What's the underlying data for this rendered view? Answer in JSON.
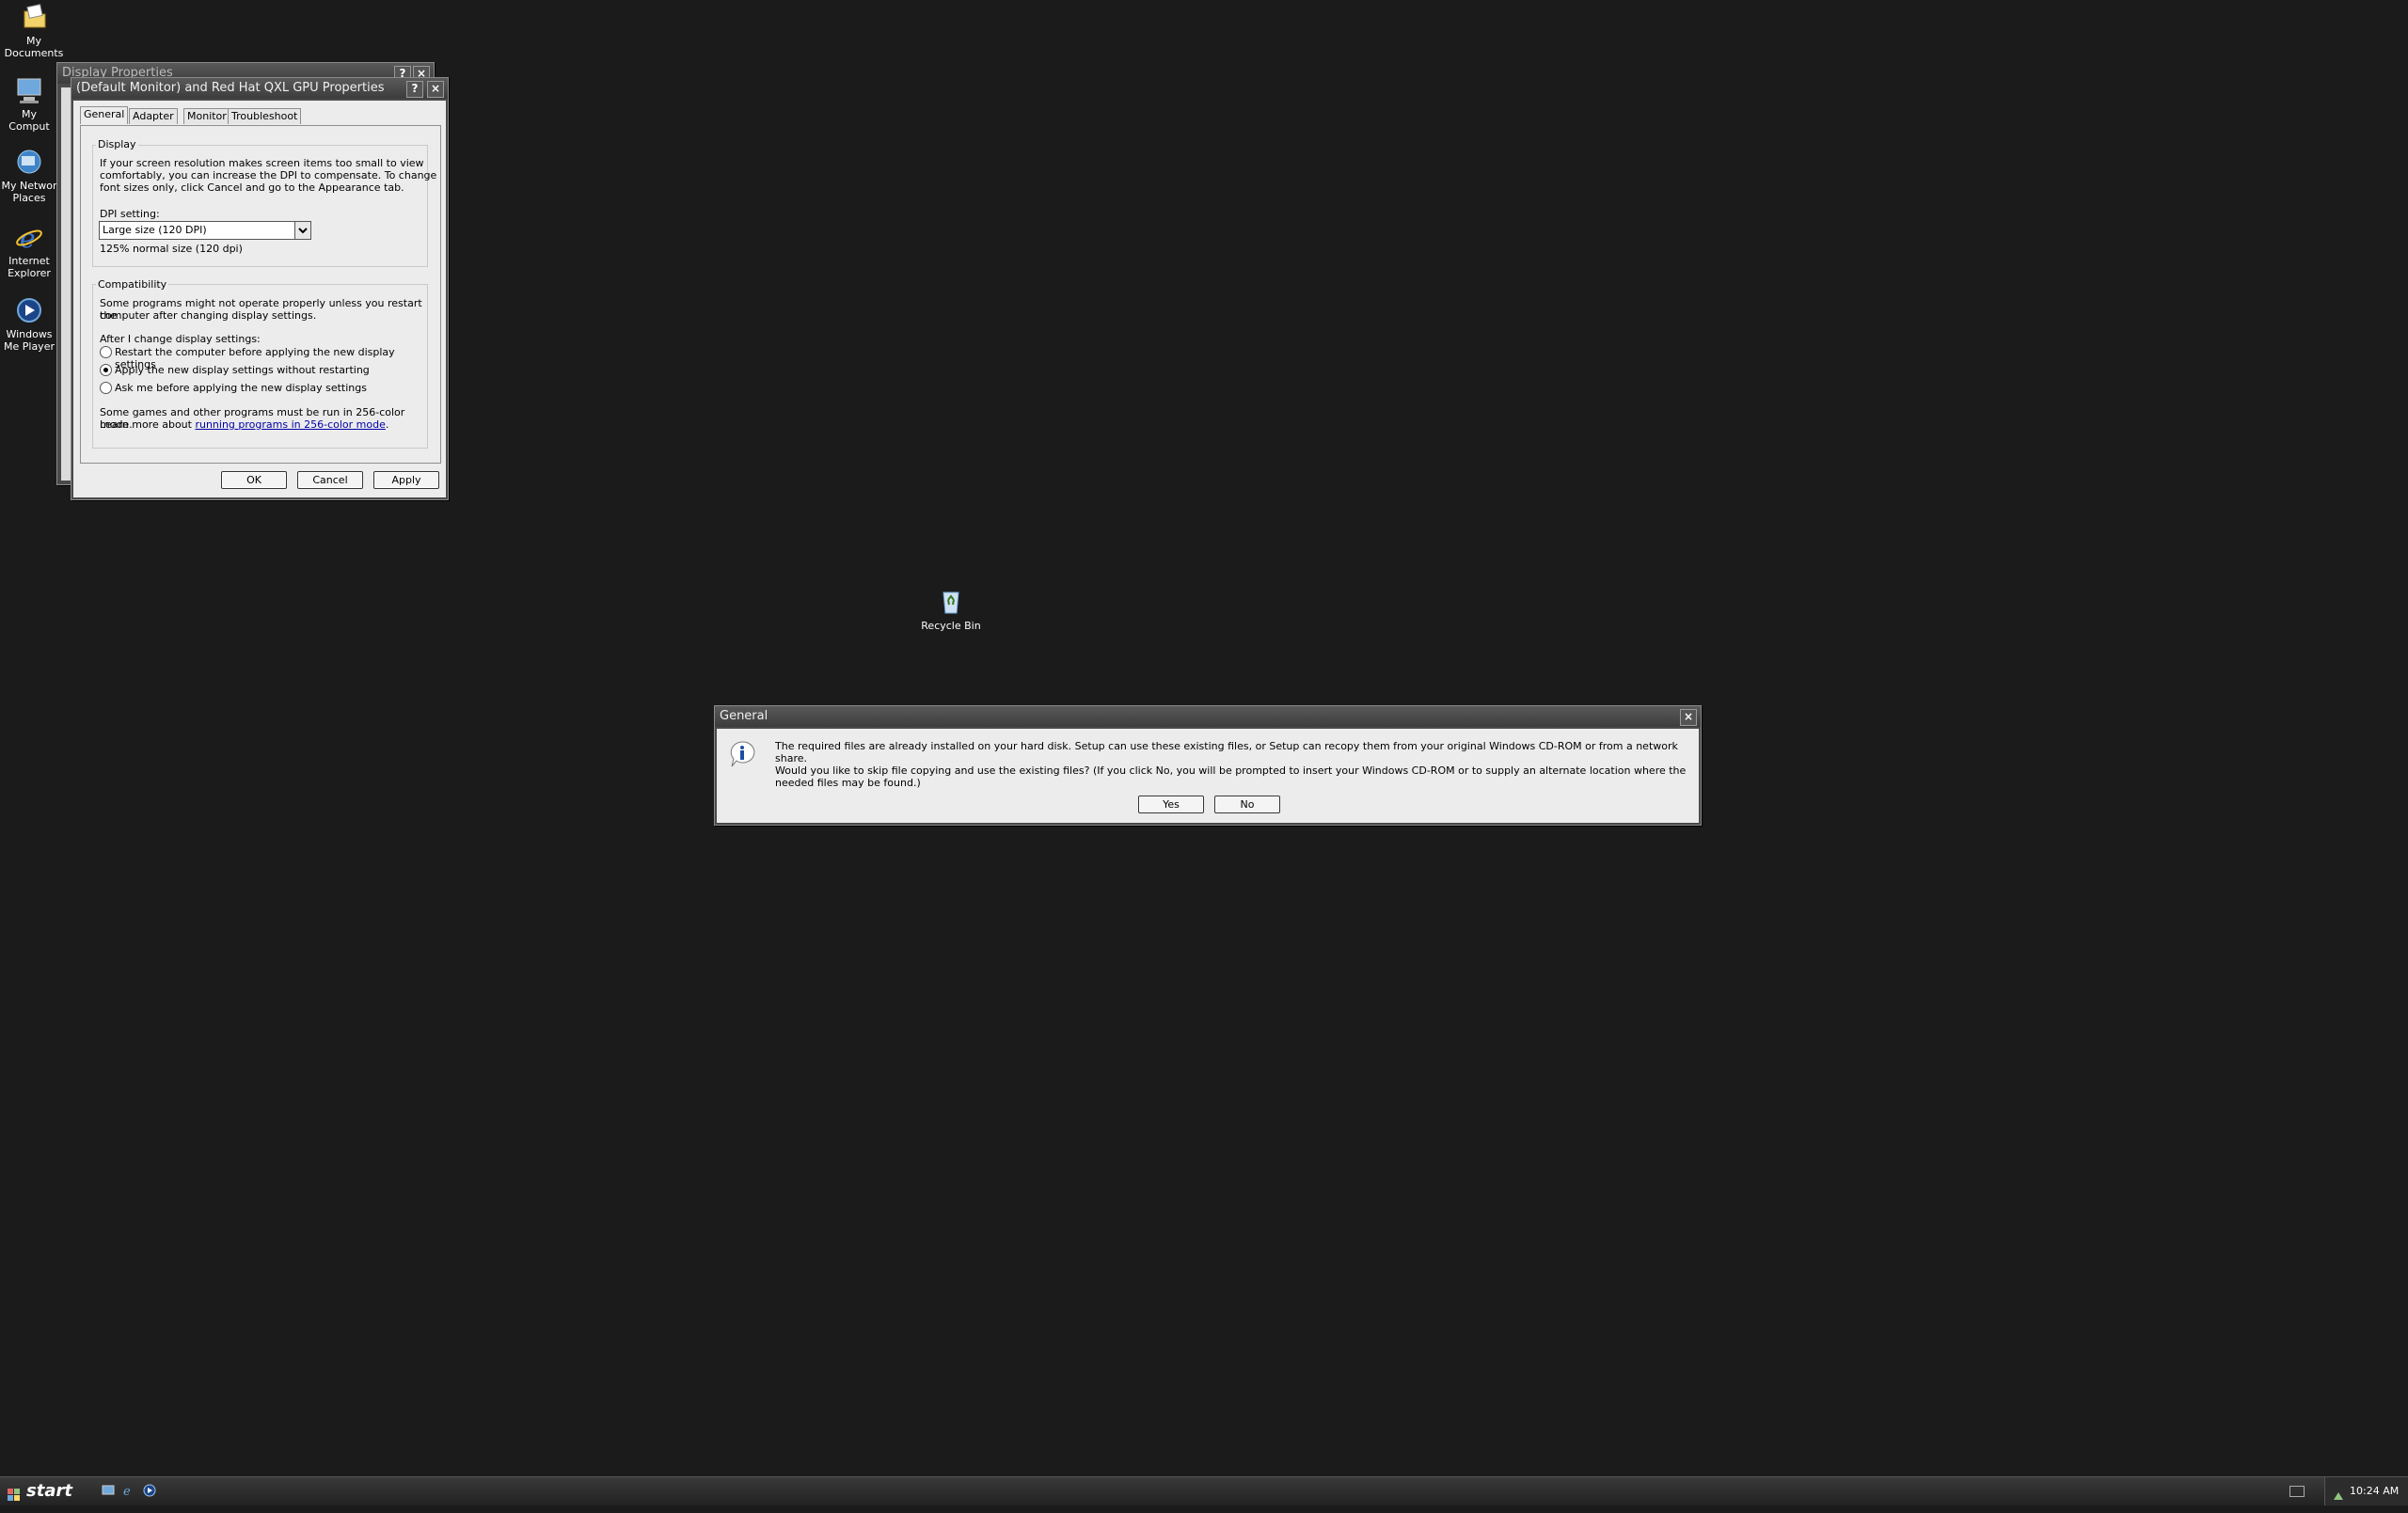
{
  "desktop": {
    "icons": [
      {
        "label": "My Documents",
        "icon": "documents-icon"
      },
      {
        "label": "My Comput",
        "icon": "computer-icon"
      },
      {
        "label": "My Networ Places",
        "icon": "network-places-icon"
      },
      {
        "label": "Internet Explorer",
        "icon": "internet-explorer-icon"
      },
      {
        "label": "Windows Me Player",
        "icon": "media-player-icon"
      },
      {
        "label": "Recycle Bin",
        "icon": "recycle-bin-icon"
      }
    ]
  },
  "bg_window": {
    "title": "Display Properties",
    "help": "?",
    "close": "×"
  },
  "props_window": {
    "title": "(Default Monitor) and Red Hat QXL GPU Properties",
    "help": "?",
    "close": "×",
    "tabs": [
      "General",
      "Adapter",
      "Monitor",
      "Troubleshoot"
    ],
    "display_group": {
      "title": "Display",
      "desc_lines": [
        "If your screen resolution makes screen items too small to view",
        "comfortably, you can increase the DPI to compensate.  To change",
        "font sizes only, click Cancel and go to the Appearance tab."
      ],
      "dpi_label": "DPI setting:",
      "dpi_value": "Large size (120 DPI)",
      "dpi_note": "125% normal size (120 dpi)"
    },
    "compat_group": {
      "title": "Compatibility",
      "desc_lines": [
        "Some programs might not operate properly unless you restart the",
        "computer after changing display settings."
      ],
      "after_label": "After I change display settings:",
      "options": [
        "Restart the computer before applying the new display settings",
        "Apply the new display settings without restarting",
        "Ask me before applying the new display settings"
      ],
      "selected_index": 1,
      "note_line1": "Some games and other programs must be run in 256-color mode.",
      "note_prefix": "Learn more about ",
      "note_link": "running programs in 256-color mode",
      "note_suffix": "."
    },
    "buttons": {
      "ok": "OK",
      "cancel": "Cancel",
      "apply": "Apply"
    }
  },
  "general_dialog": {
    "title": "General",
    "close": "×",
    "line1": "The required files are already installed on your hard disk. Setup can use these existing files, or Setup can recopy them from your original Windows CD-ROM or from a network share.",
    "line2": "Would you like to skip file copying and use the existing files? (If you click No, you will be prompted to insert your Windows CD-ROM or to supply an alternate location where the needed files may be found.)",
    "yes": "Yes",
    "no": "No"
  },
  "taskbar": {
    "start": "start",
    "quick_launch": [
      "show-desktop-icon",
      "internet-explorer-icon",
      "media-player-icon"
    ],
    "clock": "10:24 AM"
  }
}
